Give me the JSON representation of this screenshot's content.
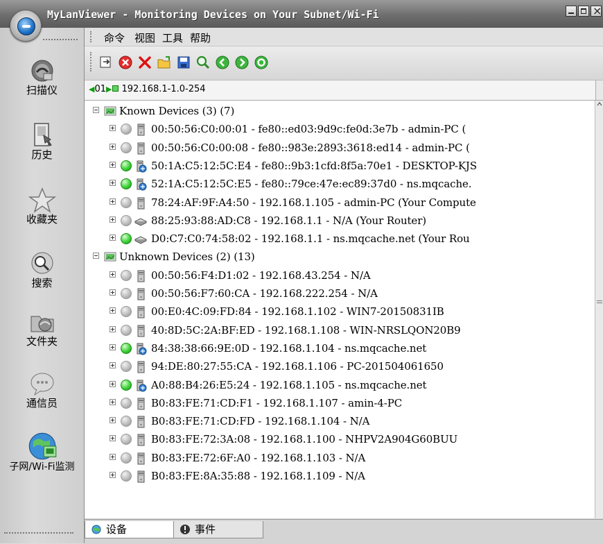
{
  "window": {
    "title": "MyLanViewer - Monitoring Devices on Your Subnet/Wi-Fi"
  },
  "sidebar": {
    "items": [
      {
        "label": "扫描仪",
        "icon": "scanner-icon"
      },
      {
        "label": "历史",
        "icon": "history-icon"
      },
      {
        "label": "收藏夹",
        "icon": "favorites-icon"
      },
      {
        "label": "搜索",
        "icon": "search-icon"
      },
      {
        "label": "文件夹",
        "icon": "shared-folders-icon"
      },
      {
        "label": "通信员",
        "icon": "messenger-icon"
      },
      {
        "label": "子网/Wi-Fi监测",
        "icon": "subnet-monitor-icon"
      }
    ]
  },
  "menu": {
    "items": [
      "命令",
      "视图",
      "工具",
      "帮助"
    ]
  },
  "toolbar": {
    "buttons": [
      "export-icon",
      "stop-icon",
      "delete-icon",
      "open-icon",
      "save-icon",
      "find-icon",
      "back-icon",
      "forward-icon",
      "refresh-icon"
    ]
  },
  "address": {
    "prefix": "01",
    "range": "192.168.1-1.0-254"
  },
  "tree": {
    "groups": [
      {
        "label": "Known Devices (3) (7)",
        "devices": [
          {
            "text": "00:50:56:C0:00:01 - fe80::ed03:9d9c:fe0d:3e7b - admin-PC (",
            "online": false,
            "kind": "pc"
          },
          {
            "text": "00:50:56:C0:00:08 - fe80::983e:2893:3618:ed14 - admin-PC (",
            "online": false,
            "kind": "pc"
          },
          {
            "text": "50:1A:C5:12:5C:E4 - fe80::9b3:1cfd:8f5a:70e1 - DESKTOP-KJS",
            "online": true,
            "kind": "pc-net"
          },
          {
            "text": "52:1A:C5:12:5C:E5 - fe80::79ce:47e:ec89:37d0 - ns.mqcache.",
            "online": true,
            "kind": "pc-net"
          },
          {
            "text": "78:24:AF:9F:A4:50 - 192.168.1.105 - admin-PC (Your Compute",
            "online": false,
            "kind": "pc"
          },
          {
            "text": "88:25:93:88:AD:C8 - 192.168.1.1 - N/A (Your Router)",
            "online": false,
            "kind": "router"
          },
          {
            "text": "D0:C7:C0:74:58:02 - 192.168.1.1 - ns.mqcache.net (Your Rou",
            "online": true,
            "kind": "router"
          }
        ]
      },
      {
        "label": "Unknown Devices (2) (13)",
        "devices": [
          {
            "text": "00:50:56:F4:D1:02 - 192.168.43.254 - N/A",
            "online": false,
            "kind": "pc"
          },
          {
            "text": "00:50:56:F7:60:CA - 192.168.222.254 - N/A",
            "online": false,
            "kind": "pc"
          },
          {
            "text": "00:E0:4C:09:FD:84 - 192.168.1.102 - WIN7-20150831IB",
            "online": false,
            "kind": "pc"
          },
          {
            "text": "40:8D:5C:2A:BF:ED - 192.168.1.108 - WIN-NRSLQON20B9",
            "online": false,
            "kind": "pc"
          },
          {
            "text": "84:38:38:66:9E:0D - 192.168.1.104 - ns.mqcache.net",
            "online": true,
            "kind": "pc-net"
          },
          {
            "text": "94:DE:80:27:55:CA - 192.168.1.106 - PC-201504061650",
            "online": false,
            "kind": "pc"
          },
          {
            "text": "A0:88:B4:26:E5:24 - 192.168.1.105 - ns.mqcache.net",
            "online": true,
            "kind": "pc-net"
          },
          {
            "text": "B0:83:FE:71:CD:F1 - 192.168.1.107 - amin-4-PC",
            "online": false,
            "kind": "pc"
          },
          {
            "text": "B0:83:FE:71:CD:FD - 192.168.1.104 - N/A",
            "online": false,
            "kind": "pc"
          },
          {
            "text": "B0:83:FE:72:3A:08 - 192.168.1.100 - NHPV2A904G60BUU",
            "online": false,
            "kind": "pc"
          },
          {
            "text": "B0:83:FE:72:6F:A0 - 192.168.1.103 - N/A",
            "online": false,
            "kind": "pc"
          },
          {
            "text": "B0:83:FE:8A:35:88 - 192.168.1.109 - N/A",
            "online": false,
            "kind": "pc"
          }
        ]
      }
    ]
  },
  "tabs": {
    "devices": "设备",
    "events": "事件"
  }
}
